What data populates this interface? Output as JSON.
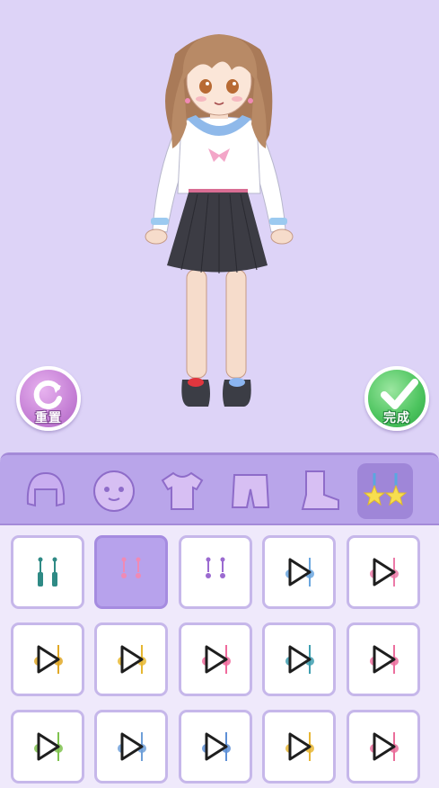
{
  "app": {
    "reset_label": "重置",
    "done_label": "完成"
  },
  "categories": [
    {
      "name": "hair",
      "icon": "hair-icon"
    },
    {
      "name": "face",
      "icon": "face-icon"
    },
    {
      "name": "top",
      "icon": "shirt-icon"
    },
    {
      "name": "bottom",
      "icon": "shorts-icon"
    },
    {
      "name": "shoes",
      "icon": "boot-icon"
    },
    {
      "name": "accessory",
      "icon": "star-earring-icon",
      "active": true
    }
  ],
  "items": [
    {
      "id": 1,
      "kind": "earring",
      "icon": "teal-tassel-earring-icon",
      "ad_locked": false,
      "selected": false
    },
    {
      "id": 2,
      "kind": "earring",
      "icon": "pink-stud-earring-icon",
      "ad_locked": false,
      "selected": true
    },
    {
      "id": 3,
      "kind": "earring",
      "icon": "purple-drop-earring-icon",
      "ad_locked": false,
      "selected": false
    },
    {
      "id": 4,
      "kind": "earring",
      "icon": "blue-earring-icon",
      "ad_locked": true,
      "selected": false
    },
    {
      "id": 5,
      "kind": "earring",
      "icon": "pink-earring-icon",
      "ad_locked": true,
      "selected": false
    },
    {
      "id": 6,
      "kind": "earring",
      "icon": "gold-ornate-earring-icon",
      "ad_locked": true,
      "selected": false
    },
    {
      "id": 7,
      "kind": "earring",
      "icon": "gold-hoop-earring-icon",
      "ad_locked": true,
      "selected": false
    },
    {
      "id": 8,
      "kind": "earring",
      "icon": "pink-bow-earring-icon",
      "ad_locked": true,
      "selected": false
    },
    {
      "id": 9,
      "kind": "earring",
      "icon": "teal-flower-earring-icon",
      "ad_locked": true,
      "selected": false
    },
    {
      "id": 10,
      "kind": "earring",
      "icon": "pink-tassel-earring-icon",
      "ad_locked": true,
      "selected": false
    },
    {
      "id": 11,
      "kind": "earring",
      "icon": "green-earring-icon",
      "ad_locked": true,
      "selected": false
    },
    {
      "id": 12,
      "kind": "earring",
      "icon": "blue-chain-earring-icon",
      "ad_locked": true,
      "selected": false
    },
    {
      "id": 13,
      "kind": "earring",
      "icon": "blue-ring-earring-icon",
      "ad_locked": true,
      "selected": false
    },
    {
      "id": 14,
      "kind": "earring",
      "icon": "gold-moon-earring-icon",
      "ad_locked": true,
      "selected": false
    },
    {
      "id": 15,
      "kind": "earring",
      "icon": "pink-drop-earring-icon",
      "ad_locked": true,
      "selected": false
    }
  ],
  "colors": {
    "background": "#ddd3f7",
    "panel": "#efe9fb",
    "category_bar": "#b9a5ea",
    "selected_item": "#b7a2ec",
    "reset_button": "#c681d6",
    "done_button": "#4cc45e"
  }
}
